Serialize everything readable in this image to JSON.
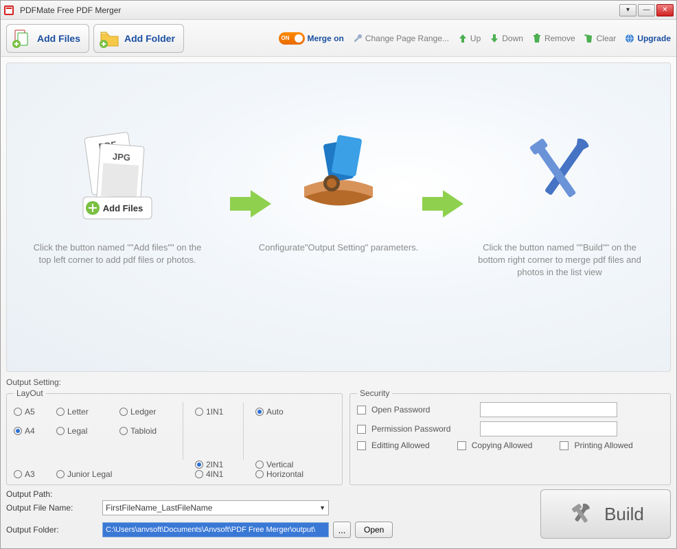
{
  "window": {
    "title": "PDFMate Free PDF Merger"
  },
  "toolbar": {
    "add_files": "Add Files",
    "add_folder": "Add Folder",
    "switch_label": "ON",
    "merge_on": "Merge on",
    "change_range": "Change Page Range...",
    "up": "Up",
    "down": "Down",
    "remove": "Remove",
    "clear": "Clear",
    "upgrade": "Upgrade"
  },
  "canvas": {
    "step1": "Click the button named \"\"Add files\"\" on the top left corner to add pdf files or photos.",
    "step1_btn": "Add Files",
    "step1_pdf": "PDF",
    "step1_jpg": "JPG",
    "step2": "Configurate\"Output Setting\" parameters.",
    "step3": "Click the button named \"\"Build\"\" on the bottom right corner to merge pdf files and photos in the list view"
  },
  "settings": {
    "header": "Output Setting:",
    "layout_legend": "LayOut",
    "sizes": [
      "A5",
      "A4",
      "A3",
      "Letter",
      "Legal",
      "Junior Legal",
      "Ledger",
      "Tabloid"
    ],
    "selected_size": "A4",
    "nin": [
      "1IN1",
      "2IN1",
      "4IN1"
    ],
    "selected_nin": "2IN1",
    "orient": [
      "Auto",
      "Vertical",
      "Horizontal"
    ],
    "selected_orient": "Auto",
    "security_legend": "Security",
    "open_pw": "Open Password",
    "perm_pw": "Permission Password",
    "edit_allowed": "Editting Allowed",
    "copy_allowed": "Copying Allowed",
    "print_allowed": "Printing Allowed"
  },
  "output": {
    "header": "Output Path:",
    "file_name_label": "Output File Name:",
    "file_name_value": "FirstFileName_LastFileName",
    "folder_label": "Output Folder:",
    "folder_value": "C:\\Users\\anvsoft\\Documents\\Anvsoft\\PDF Free Merger\\output\\",
    "browse": "...",
    "open": "Open",
    "build": "Build"
  }
}
